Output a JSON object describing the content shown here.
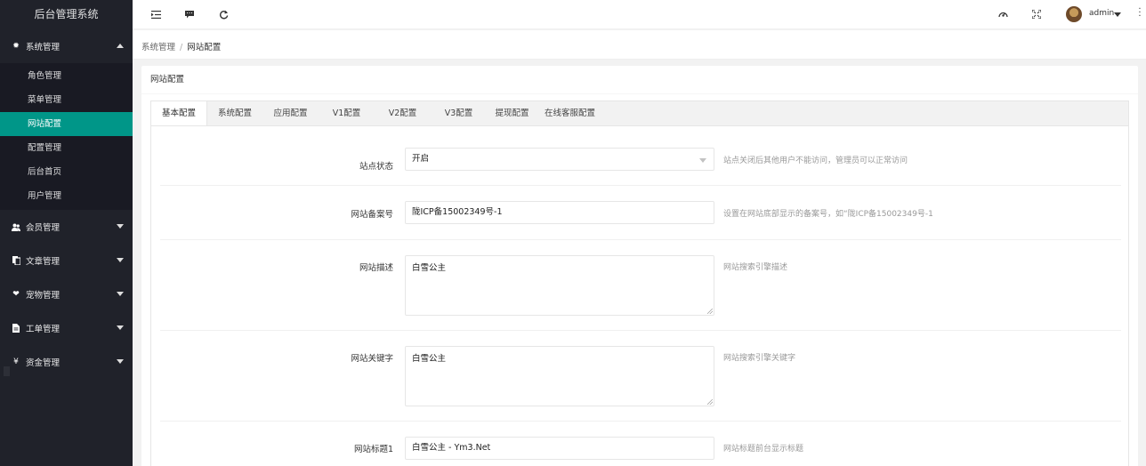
{
  "app": {
    "title": "后台管理系统"
  },
  "sidebar": {
    "groups": [
      {
        "label": "系统管理",
        "icon": "gear-icon",
        "expanded": true,
        "items": [
          "角色管理",
          "菜单管理",
          "网站配置",
          "配置管理",
          "后台首页",
          "用户管理"
        ],
        "active_index": 2
      },
      {
        "label": "会员管理",
        "icon": "users-icon"
      },
      {
        "label": "文章管理",
        "icon": "copy-icon"
      },
      {
        "label": "宠物管理",
        "icon": "heart-icon"
      },
      {
        "label": "工单管理",
        "icon": "file-icon"
      },
      {
        "label": "资金管理",
        "icon": "yen-icon"
      }
    ]
  },
  "header": {
    "icons": [
      "menu-shrink-icon",
      "message-icon",
      "refresh-icon",
      "theme-icon",
      "fullscreen-icon",
      "more-icon"
    ],
    "user": "admin"
  },
  "breadcrumb": {
    "parent": "系统管理",
    "separator": "/",
    "current": "网站配置"
  },
  "card": {
    "title": "网站配置",
    "tabs": [
      "基本配置",
      "系统配置",
      "应用配置",
      "V1配置",
      "V2配置",
      "V3配置",
      "提现配置",
      "在线客服配置"
    ],
    "active_tab": 0
  },
  "form": {
    "site_status": {
      "label": "站点状态",
      "value": "开启",
      "hint": "站点关闭后其他用户不能访问，管理员可以正常访问"
    },
    "icp": {
      "label": "网站备案号",
      "value": "陇ICP备15002349号-1",
      "hint": "设置在网站底部显示的备案号，如“陇ICP备15002349号-1"
    },
    "description": {
      "label": "网站描述",
      "value": "白雪公主",
      "hint": "网站搜索引擎描述"
    },
    "keywords": {
      "label": "网站关键字",
      "value": "白雪公主",
      "hint": "网站搜索引擎关键字"
    },
    "title1": {
      "label": "网站标题1",
      "value": "白雪公主 - Ym3.Net",
      "hint": "网站标题前台显示标题"
    }
  },
  "colors": {
    "sidebar_bg": "#20222a",
    "accent": "#009688"
  }
}
